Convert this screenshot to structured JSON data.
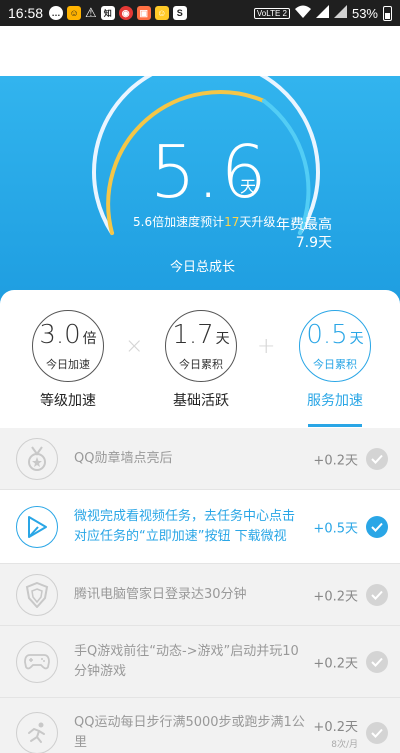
{
  "status_bar": {
    "time": "16:58",
    "notification_icons": [
      "chat-bubble-icon",
      "app-icon",
      "warning-icon",
      "zhihu-icon",
      "weibo-icon",
      "app-icon",
      "app-icon",
      "s-app-icon"
    ],
    "zhihu_label": "知",
    "network_label": "VoLTE 2",
    "battery": "53%"
  },
  "hero": {
    "value": "5.6",
    "unit": "天",
    "predict_prefix": "5.6倍加速度预计",
    "predict_days": "17",
    "predict_suffix": "天升级",
    "annual_label": "年费最高",
    "annual_value": "7.9天",
    "today_growth": "今日总成长",
    "arc_colors": {
      "track": "#eaf5ff",
      "gold": "#f4c647",
      "blue": "#52cdf5"
    }
  },
  "boosts": [
    {
      "value": "3.0",
      "unit": "倍",
      "sub": "今日加速",
      "label": "等级加速",
      "active": false
    },
    {
      "value": "1.7",
      "unit": "天",
      "sub": "今日累积",
      "label": "基础活跃",
      "active": false
    },
    {
      "value": "0.5",
      "unit": "天",
      "sub": "今日累积",
      "label": "服务加速",
      "active": true
    }
  ],
  "operators": [
    "×",
    "+"
  ],
  "tasks": [
    {
      "icon": "medal-icon",
      "text": "QQ勋章墙点亮后",
      "bonus": "+0.2天",
      "done": false,
      "highlight": false
    },
    {
      "icon": "play-video-icon",
      "text": "微视完成看视频任务，去任务中心点击对应任务的“立即加速”按钮 下载微视",
      "bonus": "+0.5天",
      "done": true,
      "highlight": true
    },
    {
      "icon": "shield-icon",
      "text": "腾讯电脑管家日登录达30分钟",
      "bonus": "+0.2天",
      "done": false,
      "highlight": false
    },
    {
      "icon": "gamepad-icon",
      "text": "手Q游戏前往“动态->游戏”启动并玩10分钟游戏",
      "bonus": "+0.2天",
      "done": false,
      "highlight": false
    },
    {
      "icon": "running-icon",
      "text": "QQ运动每日步行满5000步或跑步满1公里",
      "bonus": "+0.2天",
      "sub": "8次/月",
      "done": false,
      "highlight": false
    }
  ]
}
